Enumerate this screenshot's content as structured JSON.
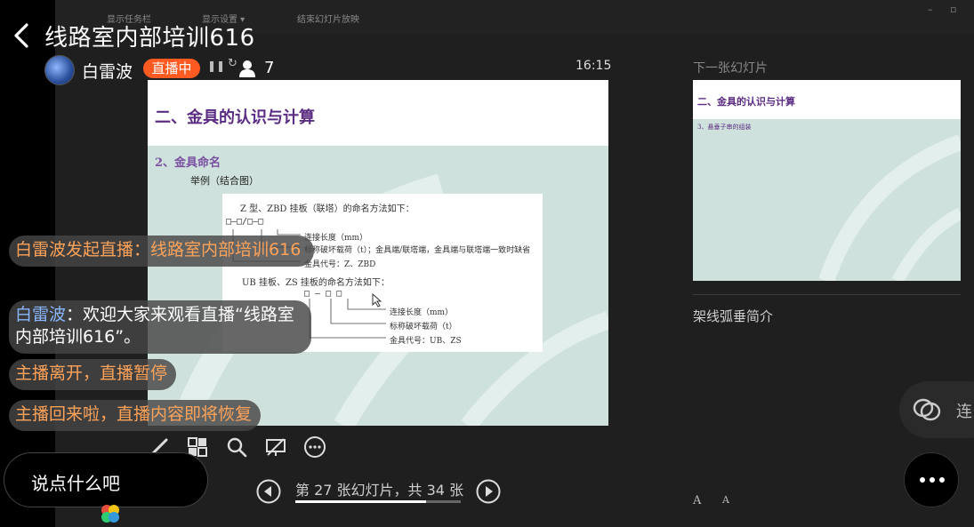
{
  "stream": {
    "title": "线路室内部培训616",
    "host": "白雷波",
    "live_badge": "直播中",
    "viewers": "7"
  },
  "ppt_toolbar": {
    "show_taskbar": "显示任务栏",
    "display_settings": "显示设置 ▾",
    "end_slideshow": "结束幻灯片放映"
  },
  "presenter": {
    "clock": "16:15",
    "next_slide_label": "下一张幻灯片",
    "notes_title": "架线弧垂简介",
    "page_info": "第 27 张幻灯片，共 34 张",
    "progress": 0.79,
    "font_up": "A",
    "font_down": "A"
  },
  "slide": {
    "title": "二、金具的认识与计算",
    "subtitle": "2、金具命名",
    "example": "举例（结合图）",
    "card_heading": "Z 型、ZBD 挂板（联塔）的命名方法如下：",
    "boxes1": "□—□/□—□",
    "line1": "连接长度（mm）",
    "line2": "标称破坏载荷（t）；金具端/联塔端，金具端与联塔端一致时缺省",
    "line3": "金具代号：Z、ZBD",
    "card_heading2": "UB 挂板、ZS 挂板的命名方法如下：",
    "boxes2": "□ — □   □",
    "line4": "连接长度（mm）",
    "line5": "标称破坏载荷（t）",
    "line6": "金具代号：UB、ZS"
  },
  "next_slide": {
    "title": "二、金具的认识与计算",
    "sub": "3、悬垂子串的组装"
  },
  "chat": [
    {
      "prefix": "白雷波发起直播：",
      "text": "线路室内部培训616",
      "prefix_color": "#ffa35a",
      "text_color": "#ffa35a"
    },
    {
      "prefix": "白雷波",
      "text": "：欢迎大家来观看直播“线路室内部培训616”。",
      "prefix_color": "#8ab6ff",
      "text_color": "#ffffff"
    },
    {
      "prefix": "",
      "text": "主播离开，直播暂停",
      "prefix_color": "#ffa35a",
      "text_color": "#ffa35a"
    },
    {
      "prefix": "",
      "text": "主播回来啦，直播内容即将恢复",
      "prefix_color": "#ffa35a",
      "text_color": "#ffa35a"
    }
  ],
  "input": {
    "placeholder": "说点什么吧"
  },
  "connect_label": "连",
  "tool_icons": [
    "pen-icon",
    "slides-grid-icon",
    "magnifier-icon",
    "screen-off-icon",
    "more-options-icon"
  ],
  "colors": {
    "live": "#ff5a22",
    "system_msg": "#ffa35a",
    "username": "#8ab6ff",
    "slide_title": "#5b2d82"
  }
}
